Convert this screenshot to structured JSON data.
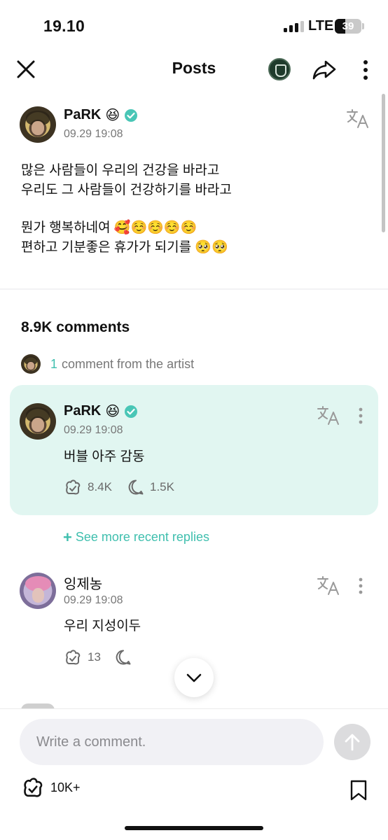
{
  "status_bar": {
    "time": "19.10",
    "network": "LTE",
    "battery": "39",
    "battery_level": 0.39,
    "signal_bars": 3,
    "signal_bars_total": 4
  },
  "header": {
    "title": "Posts",
    "icons": {
      "close": "close-icon",
      "community": "community-logo",
      "share": "share-icon",
      "more": "more-vertical-icon"
    }
  },
  "post": {
    "author": "PaRK",
    "author_emoji": "😆",
    "verified": true,
    "timestamp": "09.29 19:08",
    "lines": [
      "많은 사람들이 우리의 건강을 바라고",
      "우리도 그 사람들이 건강하기를 바라고",
      "",
      "뭔가 행복하네여 🥰☺️☺️☺️☺️",
      "편하고 기분좋은 휴가가 되기를 🥺🥺"
    ]
  },
  "comments_section": {
    "count_label": "8.9K comments",
    "artist_comment_count": "1",
    "artist_comment_text": "comment from the artist",
    "see_more_label": "See more recent replies"
  },
  "artist_comment": {
    "author": "PaRK",
    "author_emoji": "😆",
    "timestamp": "09.29 19:08",
    "text": "버블 아주 감동",
    "likes": "8.4K",
    "replies": "1.5K"
  },
  "comment": {
    "author": "잉제농",
    "timestamp": "09.29 19:08",
    "text": "우리 지성이두",
    "likes": "13"
  },
  "bottom_bar": {
    "input_placeholder": "Write a comment.",
    "like_count": "10K+"
  },
  "colors": {
    "accent": "#3fbfae",
    "artist_card_bg": "#e1f6f1",
    "verified": "#49c6b6"
  }
}
